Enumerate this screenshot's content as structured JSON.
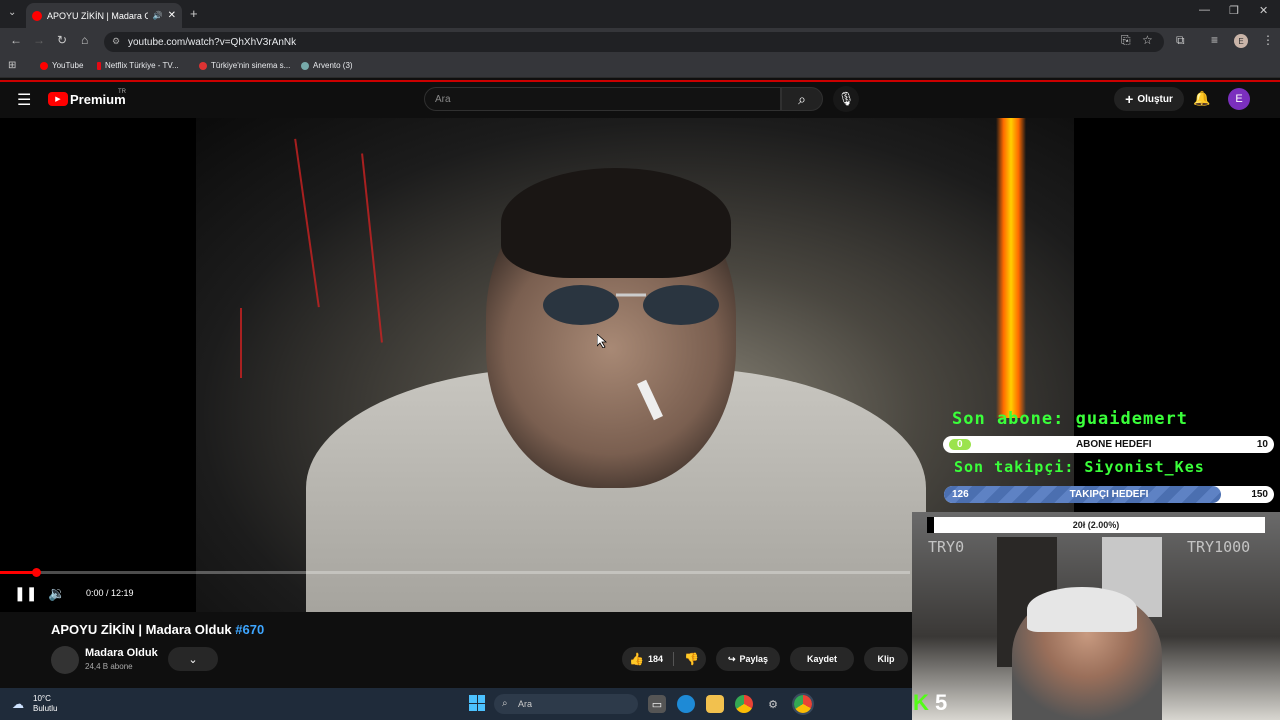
{
  "browser": {
    "tab_title": "APOYU ZİKİN | Madara Old",
    "url": "youtube.com/watch?v=QhXhV3rAnNk",
    "bookmarks": [
      "YouTube",
      "Netflix Türkiye - TV...",
      "Türkiye'nin sinema s...",
      "Arvento (3)"
    ],
    "profile_initial": "E"
  },
  "youtube": {
    "logo_text": "Premium",
    "logo_region": "TR",
    "search_placeholder": "Ara",
    "create_label": "Oluştur",
    "avatar_initial": "E"
  },
  "player": {
    "time_current": "0:00",
    "time_total": "12:19",
    "time_display": "0:00 / 12:19",
    "progress_fraction": 0.04
  },
  "stream_overlay": {
    "last_sub": "Son abone: guaidemert",
    "sub_goal_label": "ABONE HEDEFI",
    "sub_goal_current": "0",
    "sub_goal_target": "10",
    "sub_goal_fraction": 0.03,
    "last_follower": "Son takipçi: Siyonist_Kes",
    "follow_goal_label": "TAKIPÇI HEDEFI",
    "follow_goal_current": "126",
    "follow_goal_target": "150",
    "follow_goal_fraction": 0.84,
    "donation_text": "20ł (2.00%)",
    "donation_left": "TRY0",
    "donation_right": "TRY1000",
    "kick_count": "5"
  },
  "video": {
    "title": "APOYU ZİKİN | Madara Olduk",
    "hashtag": "#670",
    "channel_name": "Madara Olduk",
    "subscribers": "24,4 B abone",
    "likes": "184",
    "share_label": "Paylaş",
    "save_label": "Kaydet",
    "clip_label": "Klip"
  },
  "taskbar": {
    "temperature": "10°C",
    "weather": "Bulutlu",
    "search_placeholder": "Ara"
  },
  "colors": {
    "youtube_red": "#ff0000",
    "overlay_green": "#3aff3a",
    "kick_green": "#53fc18",
    "link_blue": "#3ea6ff"
  }
}
